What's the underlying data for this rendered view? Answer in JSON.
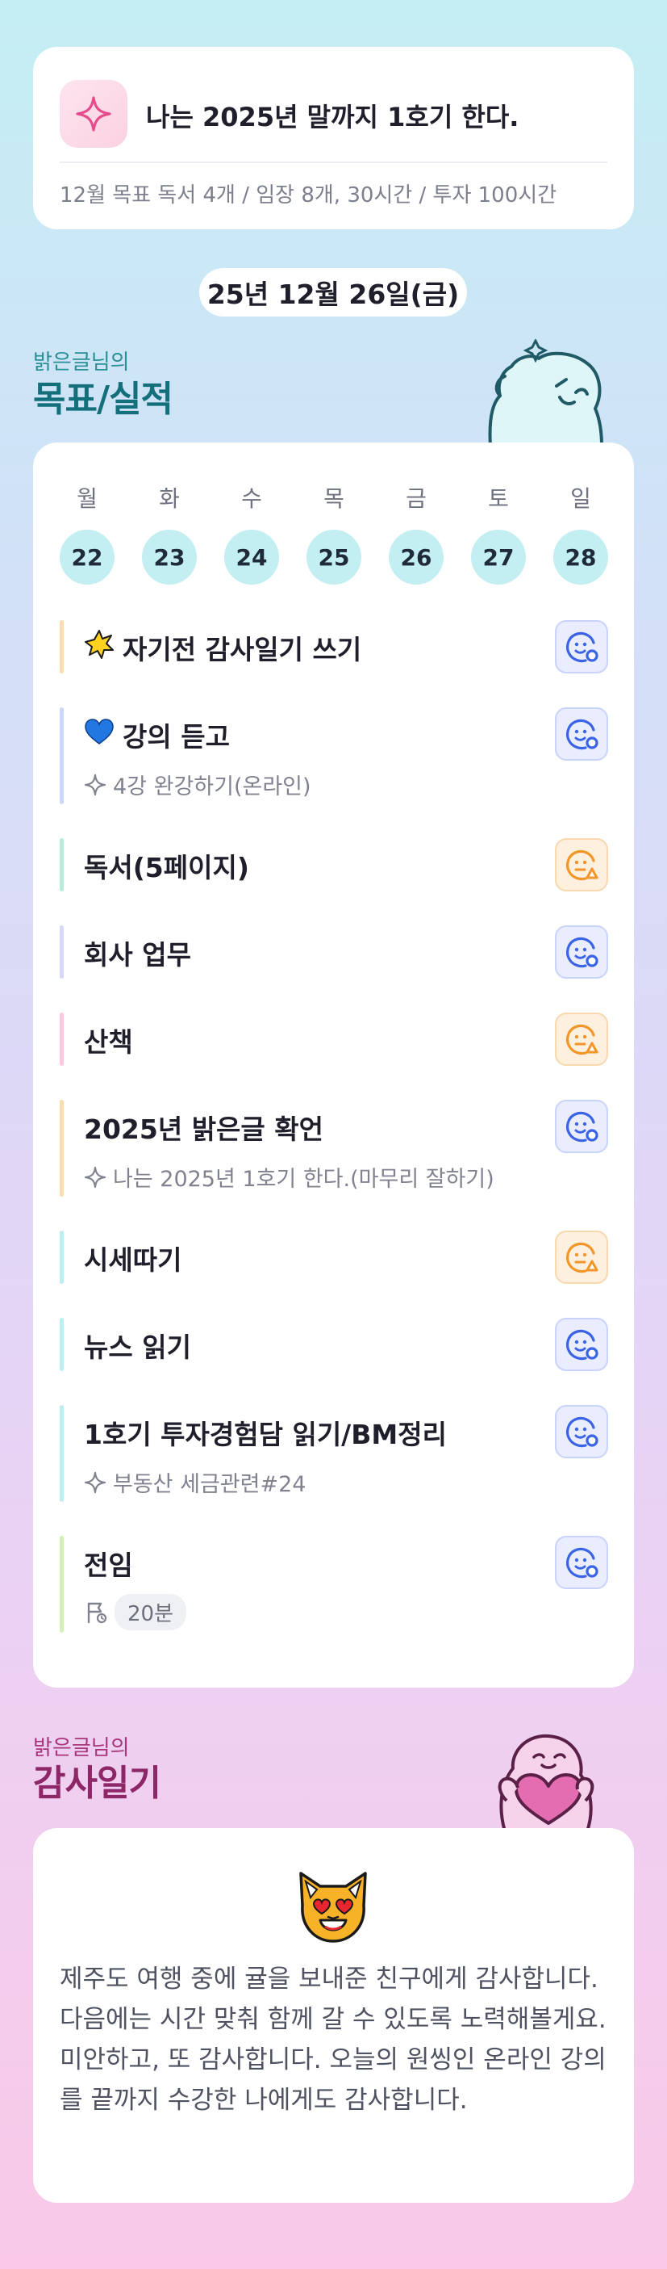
{
  "goal": {
    "title": "나는 2025년 말까지 1호기 한다.",
    "subtitle": "12월 목표  독서 4개 / 임장 8개, 30시간 / 투자 100시간",
    "icon": "sparkle-icon"
  },
  "date": "25년 12월 26일(금)",
  "goals_section": {
    "small": "밝은글님의",
    "big": "목표/실적"
  },
  "week": {
    "days": [
      "월",
      "화",
      "수",
      "목",
      "금",
      "토",
      "일"
    ],
    "dates": [
      "22",
      "23",
      "24",
      "25",
      "26",
      "27",
      "28"
    ]
  },
  "tasks": [
    {
      "title": "자기전 감사일기 쓰기",
      "icon": "star-burst-icon",
      "bar": "#fbdcb2",
      "status": "blue"
    },
    {
      "title": "강의 듣고",
      "icon": "blue-heart-icon",
      "sub": "4강 완강하기(온라인)",
      "bar": "#cfd6fb",
      "status": "blue"
    },
    {
      "title": "독서(5페이지)",
      "bar": "#b9ecd8",
      "status": "orange"
    },
    {
      "title": "회사 업무",
      "bar": "#d7d6fb",
      "status": "blue"
    },
    {
      "title": "산책",
      "bar": "#fbc9df",
      "status": "orange"
    },
    {
      "title": "2025년 밝은글 확언",
      "sub": "나는 2025년 1호기 한다.(마무리 잘하기)",
      "bar": "#fbdcb2",
      "status": "blue"
    },
    {
      "title": "시세따기",
      "bar": "#bdeef1",
      "status": "orange"
    },
    {
      "title": "뉴스 읽기",
      "bar": "#bdeef1",
      "status": "blue"
    },
    {
      "title": "1호기 투자경험담 읽기/BM정리",
      "sub": "부동산 세금관련#24",
      "bar": "#bdeef1",
      "status": "blue"
    },
    {
      "title": "전임",
      "time": "20분",
      "bar": "#d3f0b8",
      "status": "blue"
    }
  ],
  "gratitude_section": {
    "small": "밝은글님의",
    "big": "감사일기"
  },
  "gratitude": {
    "emoji": "heart-eyes-cat-icon",
    "text": "제주도 여행 중에 귤을 보내준 친구에게 감사합니다. 다음에는 시간 맞춰 함께 갈 수 있도록 노력해볼게요. 미안하고, 또 감사합니다. 오늘의 원씽인 온라인 강의를 끝까지 수강한 나에게도 감사합니다."
  },
  "colors": {
    "blue_status": "#3a63e6",
    "orange_status": "#f2962a",
    "teal_title": "#13707a",
    "pink_title": "#8d2767"
  }
}
